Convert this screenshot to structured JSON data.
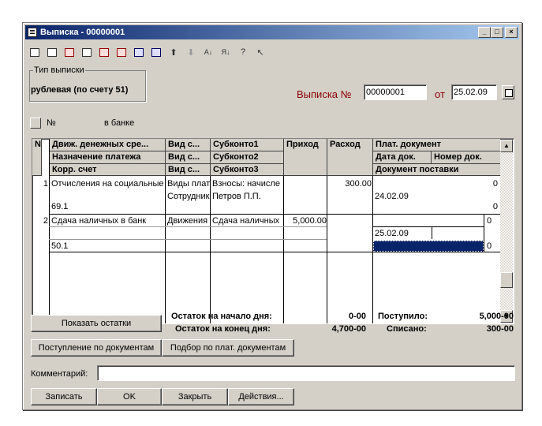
{
  "window": {
    "title": "Выписка - 00000001",
    "min": "_",
    "max": "□",
    "close": "×"
  },
  "type_group": {
    "legend": "Тип выписки",
    "value": "рублевая (по счету 51)"
  },
  "header": {
    "statement_label": "Выписка №",
    "statement_no": "00000001",
    "from_label": "от",
    "date": "25.02.09"
  },
  "bank": {
    "no_label": "№",
    "bank_label": "в банке"
  },
  "grid": {
    "headers": {
      "n": "N",
      "c1": [
        "Движ. денежных сре...",
        "Назначение платежа",
        "Корр. счет"
      ],
      "c2": [
        "Вид с...",
        "Вид с...",
        "Вид с..."
      ],
      "c3": [
        "Субконто1",
        "Субконто2",
        "Субконто3"
      ],
      "in": "Приход",
      "out": "Расход",
      "doc": [
        "Плат. документ",
        "Дата док.",
        "Номер док.",
        "Документ поставки"
      ]
    },
    "rows": [
      {
        "n": "1",
        "c1": [
          "Отчисления на социальные",
          "",
          "69.1"
        ],
        "c2": [
          "Виды плат",
          "Сотрудник",
          ""
        ],
        "c3": [
          "Взносы: начисле",
          "Петров П.П.",
          ""
        ],
        "in": "",
        "out": "300.00",
        "doc": [
          "0",
          "24.02.09",
          "0"
        ]
      },
      {
        "n": "2",
        "c1": [
          "Сдача наличных в банк",
          "",
          "50.1"
        ],
        "c2": [
          "Движения",
          "",
          ""
        ],
        "c3": [
          "Сдача наличных",
          "",
          ""
        ],
        "in": "5,000.00",
        "out": "",
        "doc": [
          "0",
          "25.02.09",
          "0"
        ]
      }
    ]
  },
  "totals": {
    "start_label": "Остаток на начало дня:",
    "start": "0-00",
    "end_label": "Остаток на конец дня:",
    "end": "4,700-00",
    "in_label": "Поступило:",
    "in": "5,000-00",
    "out_label": "Списано:",
    "out": "300-00"
  },
  "buttons": {
    "show_rest": "Показать остатки",
    "by_docs": "Поступление по документам",
    "pick": "Подбор по плат. документам",
    "save": "Записать",
    "ok": "OK",
    "close": "Закрыть",
    "actions": "Действия..."
  },
  "comment": {
    "label": "Комментарий:",
    "value": ""
  }
}
